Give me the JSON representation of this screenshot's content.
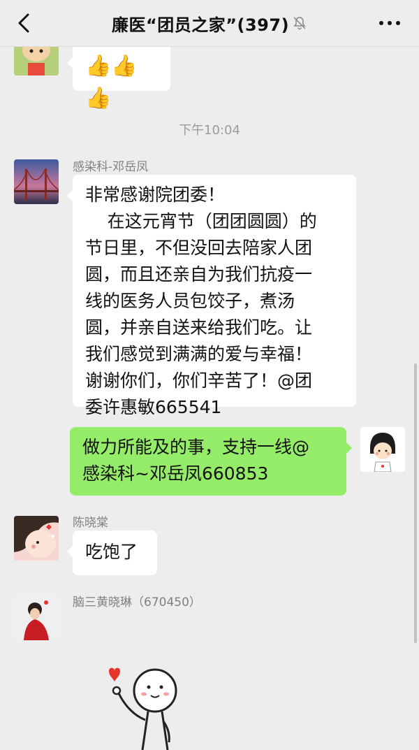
{
  "header": {
    "title": "廉医“团员之家”(397)",
    "back_icon": "chevron-left-icon",
    "mute_icon": "bell-muted-icon",
    "more_icon": "more-dots-icon"
  },
  "messages": [
    {
      "id": "m0",
      "side": "left",
      "avatar": "cartoon-boy-avatar",
      "text": "👍👍👍"
    },
    {
      "id": "time",
      "type": "timestamp",
      "text": "下午10:04"
    },
    {
      "id": "m1",
      "side": "left",
      "sender": "感染科-邓岳凤",
      "avatar": "bridge-photo-avatar",
      "lines": [
        "非常感谢院团委！",
        "    在这元宵节（团团圆圆）的",
        "节日里，不但没回去陪家人团",
        "圆，而且还亲自为我们抗疫一",
        "线的医务人员包饺子，煮汤",
        "圆，并亲自送来给我们吃。让",
        "我们感觉到满满的爱与幸福！",
        "谢谢你们，你们辛苦了！@团",
        "委许惠敏665541"
      ]
    },
    {
      "id": "m2",
      "side": "right",
      "avatar": "cartoon-girl-avatar",
      "lines": [
        "做力所能及的事，支持一线@",
        "感染科~邓岳凤660853"
      ]
    },
    {
      "id": "m3",
      "side": "left",
      "sender": "陈晓棠",
      "avatar": "cartoon-face-avatar",
      "text": "吃饱了"
    },
    {
      "id": "m4",
      "side": "left",
      "sender": "脑三黄晓琳（670450）",
      "avatar": "red-dress-photo-avatar",
      "sticker": "heart-gesture-sticker"
    }
  ],
  "colors": {
    "background": "#ededed",
    "bubble_self": "#95ec69",
    "bubble_other": "#ffffff",
    "accent_heart": "#e8322c"
  }
}
